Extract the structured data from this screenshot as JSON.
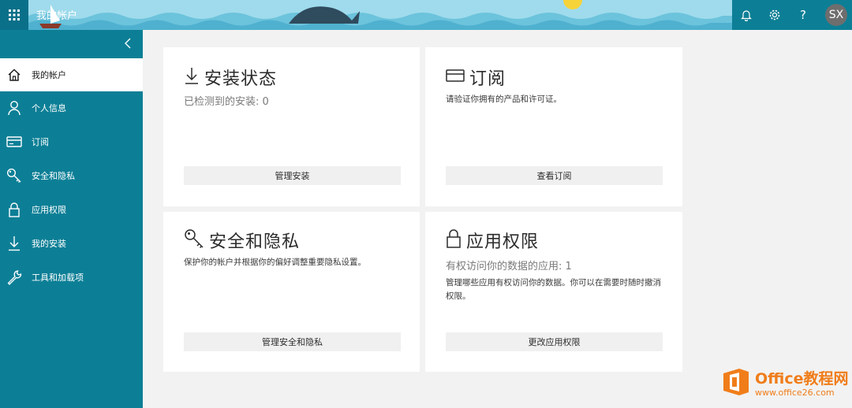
{
  "header": {
    "title": "我的帐户",
    "avatar_initials": "SX",
    "icons": [
      "app-launcher-icon",
      "bell-icon",
      "gear-icon",
      "help-icon"
    ],
    "help_glyph": "?"
  },
  "sidebar": {
    "items": [
      {
        "label": "我的帐户",
        "icon": "home-icon",
        "active": true
      },
      {
        "label": "个人信息",
        "icon": "person-icon"
      },
      {
        "label": "订阅",
        "icon": "card-icon"
      },
      {
        "label": "安全和隐私",
        "icon": "key-icon"
      },
      {
        "label": "应用权限",
        "icon": "lock-icon"
      },
      {
        "label": "我的安装",
        "icon": "download-icon"
      },
      {
        "label": "工具和加载项",
        "icon": "wrench-icon"
      }
    ]
  },
  "cards": {
    "install": {
      "title": "安装状态",
      "subtitle": "已检测到的安装: 0",
      "button": "管理安装"
    },
    "subscription": {
      "title": "订阅",
      "description": "请验证你拥有的产品和许可证。",
      "button": "查看订阅"
    },
    "security": {
      "title": "安全和隐私",
      "description": "保护你的帐户并根据你的偏好调整重要隐私设置。",
      "button": "管理安全和隐私"
    },
    "permissions": {
      "title": "应用权限",
      "subtitle": "有权访问你的数据的应用: 1",
      "description": "管理哪些应用有权访问你的数据。你可以在需要时随时撤消权限。",
      "button": "更改应用权限"
    }
  },
  "watermark": {
    "name": "Office教程网",
    "url": "www.office26.com"
  },
  "colors": {
    "sidebar": "#0c7f96",
    "banner": "#8fd3e6",
    "accent_orange": "#f07d1a"
  }
}
